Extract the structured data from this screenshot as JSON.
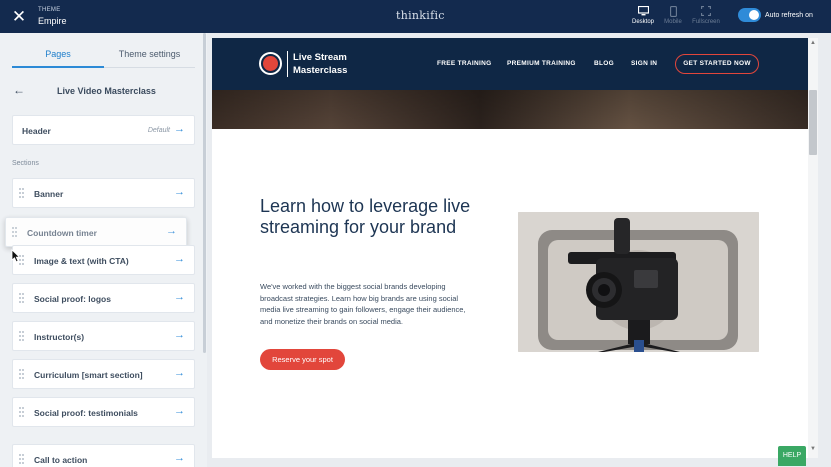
{
  "topbar": {
    "close_icon": "close-icon",
    "theme_label": "THEME",
    "theme_name": "Empire",
    "brand": "thinkific",
    "devices": [
      {
        "label": "Desktop",
        "icon": "desktop-icon",
        "active": true
      },
      {
        "label": "Mobile",
        "icon": "mobile-icon",
        "active": false
      },
      {
        "label": "Fullscreen",
        "icon": "fullscreen-icon",
        "active": false
      }
    ],
    "auto_refresh": {
      "label": "Auto refresh on",
      "on": true
    }
  },
  "panel": {
    "tabs": [
      {
        "label": "Pages",
        "active": true
      },
      {
        "label": "Theme settings",
        "active": false
      }
    ],
    "page_title": "Live Video Masterclass",
    "header_card": {
      "label": "Header",
      "tag": "Default"
    },
    "sections_label": "Sections",
    "sections": [
      {
        "label": "Banner"
      },
      {
        "label": "Countdown timer",
        "dragging": true
      },
      {
        "label": "Image & text (with CTA)"
      },
      {
        "label": "Social proof: logos"
      },
      {
        "label": "Instructor(s)"
      },
      {
        "label": "Curriculum [smart section]"
      },
      {
        "label": "Social proof: testimonials"
      },
      {
        "label": "Call to action"
      }
    ]
  },
  "preview": {
    "logo_line1": "Live Stream",
    "logo_line2": "Masterclass",
    "nav": [
      "FREE TRAINING",
      "PREMIUM TRAINING",
      "BLOG",
      "SIGN IN"
    ],
    "nav_cta": "GET STARTED NOW",
    "headline": "Learn how to leverage live streaming for your brand",
    "body": "We've worked with the biggest social brands developing broadcast strategies. Learn how big brands are using social media live streaming to gain followers, engage their audience, and monetize their brands on social media.",
    "cta": "Reserve your spot"
  },
  "help_label": "HELP",
  "colors": {
    "topbar": "#132a4e",
    "accent": "#2f8bd8",
    "brand_red": "#e2463b",
    "nav_bg": "#0f2745",
    "help": "#3aa864"
  }
}
